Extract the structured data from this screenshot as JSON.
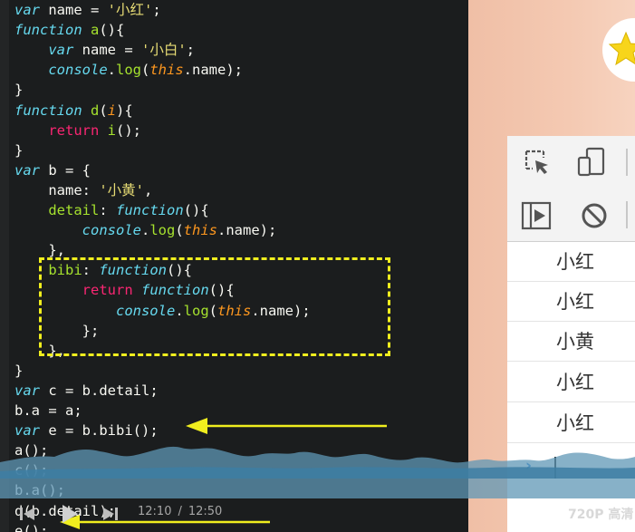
{
  "code_lines": [
    [
      [
        "kw",
        "var"
      ],
      [
        "pl",
        " name = "
      ],
      [
        "st",
        "'小红'"
      ],
      [
        "pl",
        ";"
      ]
    ],
    [
      [
        "kw",
        "function"
      ],
      [
        "pl",
        " "
      ],
      [
        "fn",
        "a"
      ],
      [
        "pl",
        "(){"
      ]
    ],
    [
      [
        "pl",
        "    "
      ],
      [
        "kw",
        "var"
      ],
      [
        "pl",
        " name = "
      ],
      [
        "st",
        "'小白'"
      ],
      [
        "pl",
        ";"
      ]
    ],
    [
      [
        "pl",
        "    "
      ],
      [
        "kw",
        "console"
      ],
      [
        "pl",
        "."
      ],
      [
        "fn",
        "log"
      ],
      [
        "pl",
        "("
      ],
      [
        "th",
        "this"
      ],
      [
        "pl",
        ".name);"
      ]
    ],
    [
      [
        "pl",
        "}"
      ]
    ],
    [
      [
        "kw",
        "function"
      ],
      [
        "pl",
        " "
      ],
      [
        "fn",
        "d"
      ],
      [
        "pl",
        "("
      ],
      [
        "th",
        "i"
      ],
      [
        "pl",
        "){"
      ]
    ],
    [
      [
        "pl",
        "    "
      ],
      [
        "rt",
        "return"
      ],
      [
        "pl",
        " "
      ],
      [
        "fn",
        "i"
      ],
      [
        "pl",
        "();"
      ]
    ],
    [
      [
        "pl",
        "}"
      ]
    ],
    [
      [
        "kw",
        "var"
      ],
      [
        "pl",
        " b = {"
      ]
    ],
    [
      [
        "pl",
        "    name: "
      ],
      [
        "st",
        "'小黄'"
      ],
      [
        "pl",
        ","
      ]
    ],
    [
      [
        "pl",
        "    "
      ],
      [
        "fn",
        "detail"
      ],
      [
        "pl",
        ": "
      ],
      [
        "kw",
        "function"
      ],
      [
        "pl",
        "(){"
      ]
    ],
    [
      [
        "pl",
        "        "
      ],
      [
        "kw",
        "console"
      ],
      [
        "pl",
        "."
      ],
      [
        "fn",
        "log"
      ],
      [
        "pl",
        "("
      ],
      [
        "th",
        "this"
      ],
      [
        "pl",
        ".name);"
      ]
    ],
    [
      [
        "pl",
        "    },"
      ]
    ],
    [
      [
        "pl",
        "    "
      ],
      [
        "fn",
        "bibi"
      ],
      [
        "pl",
        ": "
      ],
      [
        "kw",
        "function"
      ],
      [
        "pl",
        "(){"
      ]
    ],
    [
      [
        "pl",
        "        "
      ],
      [
        "rt",
        "return"
      ],
      [
        "pl",
        " "
      ],
      [
        "kw",
        "function"
      ],
      [
        "pl",
        "(){"
      ]
    ],
    [
      [
        "pl",
        "            "
      ],
      [
        "kw",
        "console"
      ],
      [
        "pl",
        "."
      ],
      [
        "fn",
        "log"
      ],
      [
        "pl",
        "("
      ],
      [
        "th",
        "this"
      ],
      [
        "pl",
        ".name);"
      ]
    ],
    [
      [
        "pl",
        "        };"
      ]
    ],
    [
      [
        "pl",
        "    },"
      ]
    ],
    [
      [
        "pl",
        "}"
      ]
    ],
    [
      [
        "kw",
        "var"
      ],
      [
        "pl",
        " c = b.detail;"
      ]
    ],
    [
      [
        "pl",
        "b.a = a;"
      ]
    ],
    [
      [
        "kw",
        "var"
      ],
      [
        "pl",
        " e = b.bibi();"
      ]
    ],
    [
      [
        "pl",
        "a();"
      ]
    ],
    [
      [
        "pl",
        "c();"
      ]
    ],
    [
      [
        "pl",
        "b.a();"
      ]
    ],
    [
      [
        "pl",
        "d(b.detail);"
      ]
    ],
    [
      [
        "pl",
        "e();"
      ]
    ]
  ],
  "console": {
    "outputs": [
      "小红",
      "小红",
      "小黄",
      "小红",
      "小红"
    ],
    "prompt_symbol": "›"
  },
  "player": {
    "current_time": "12:10",
    "separator": "/",
    "total_time": "12:50",
    "quality_label": "720P 高清"
  },
  "colors": {
    "editor_bg": "#1b1d1e",
    "keyword": "#66d9ef",
    "function_name": "#a6e22e",
    "string": "#e6db74",
    "this_keyword": "#fd971f",
    "return_keyword": "#f92672",
    "annotation_yellow": "#f0ee1e",
    "wave_blue": "#6fa5c4"
  },
  "icons": {
    "inspect": "inspect-element-icon",
    "device": "device-toggle-icon",
    "sidebar": "show-console-sidebar-icon",
    "clear": "clear-console-icon",
    "star": "star-icon",
    "prev": "skip-back-icon",
    "play": "play-icon",
    "next": "skip-forward-icon"
  }
}
